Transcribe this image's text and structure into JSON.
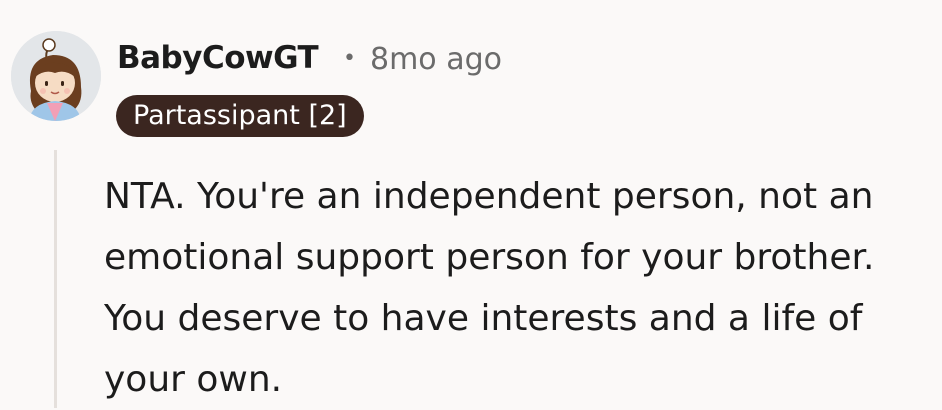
{
  "comment": {
    "author": "BabyCowGT",
    "separator": "•",
    "timestamp": "8mo ago",
    "flair": "Partassipant [2]",
    "body": "NTA. You're an independent person, not an emotional support person for your brother. You deserve to have interests and a life of your own."
  },
  "colors": {
    "background": "#fbf9f8",
    "flair_bg": "#3b2620",
    "flair_text": "#ffffff",
    "muted_text": "#6b6b6b",
    "thread_line": "#e5e0dc"
  },
  "icons": {
    "avatar": "user-avatar-icon"
  }
}
